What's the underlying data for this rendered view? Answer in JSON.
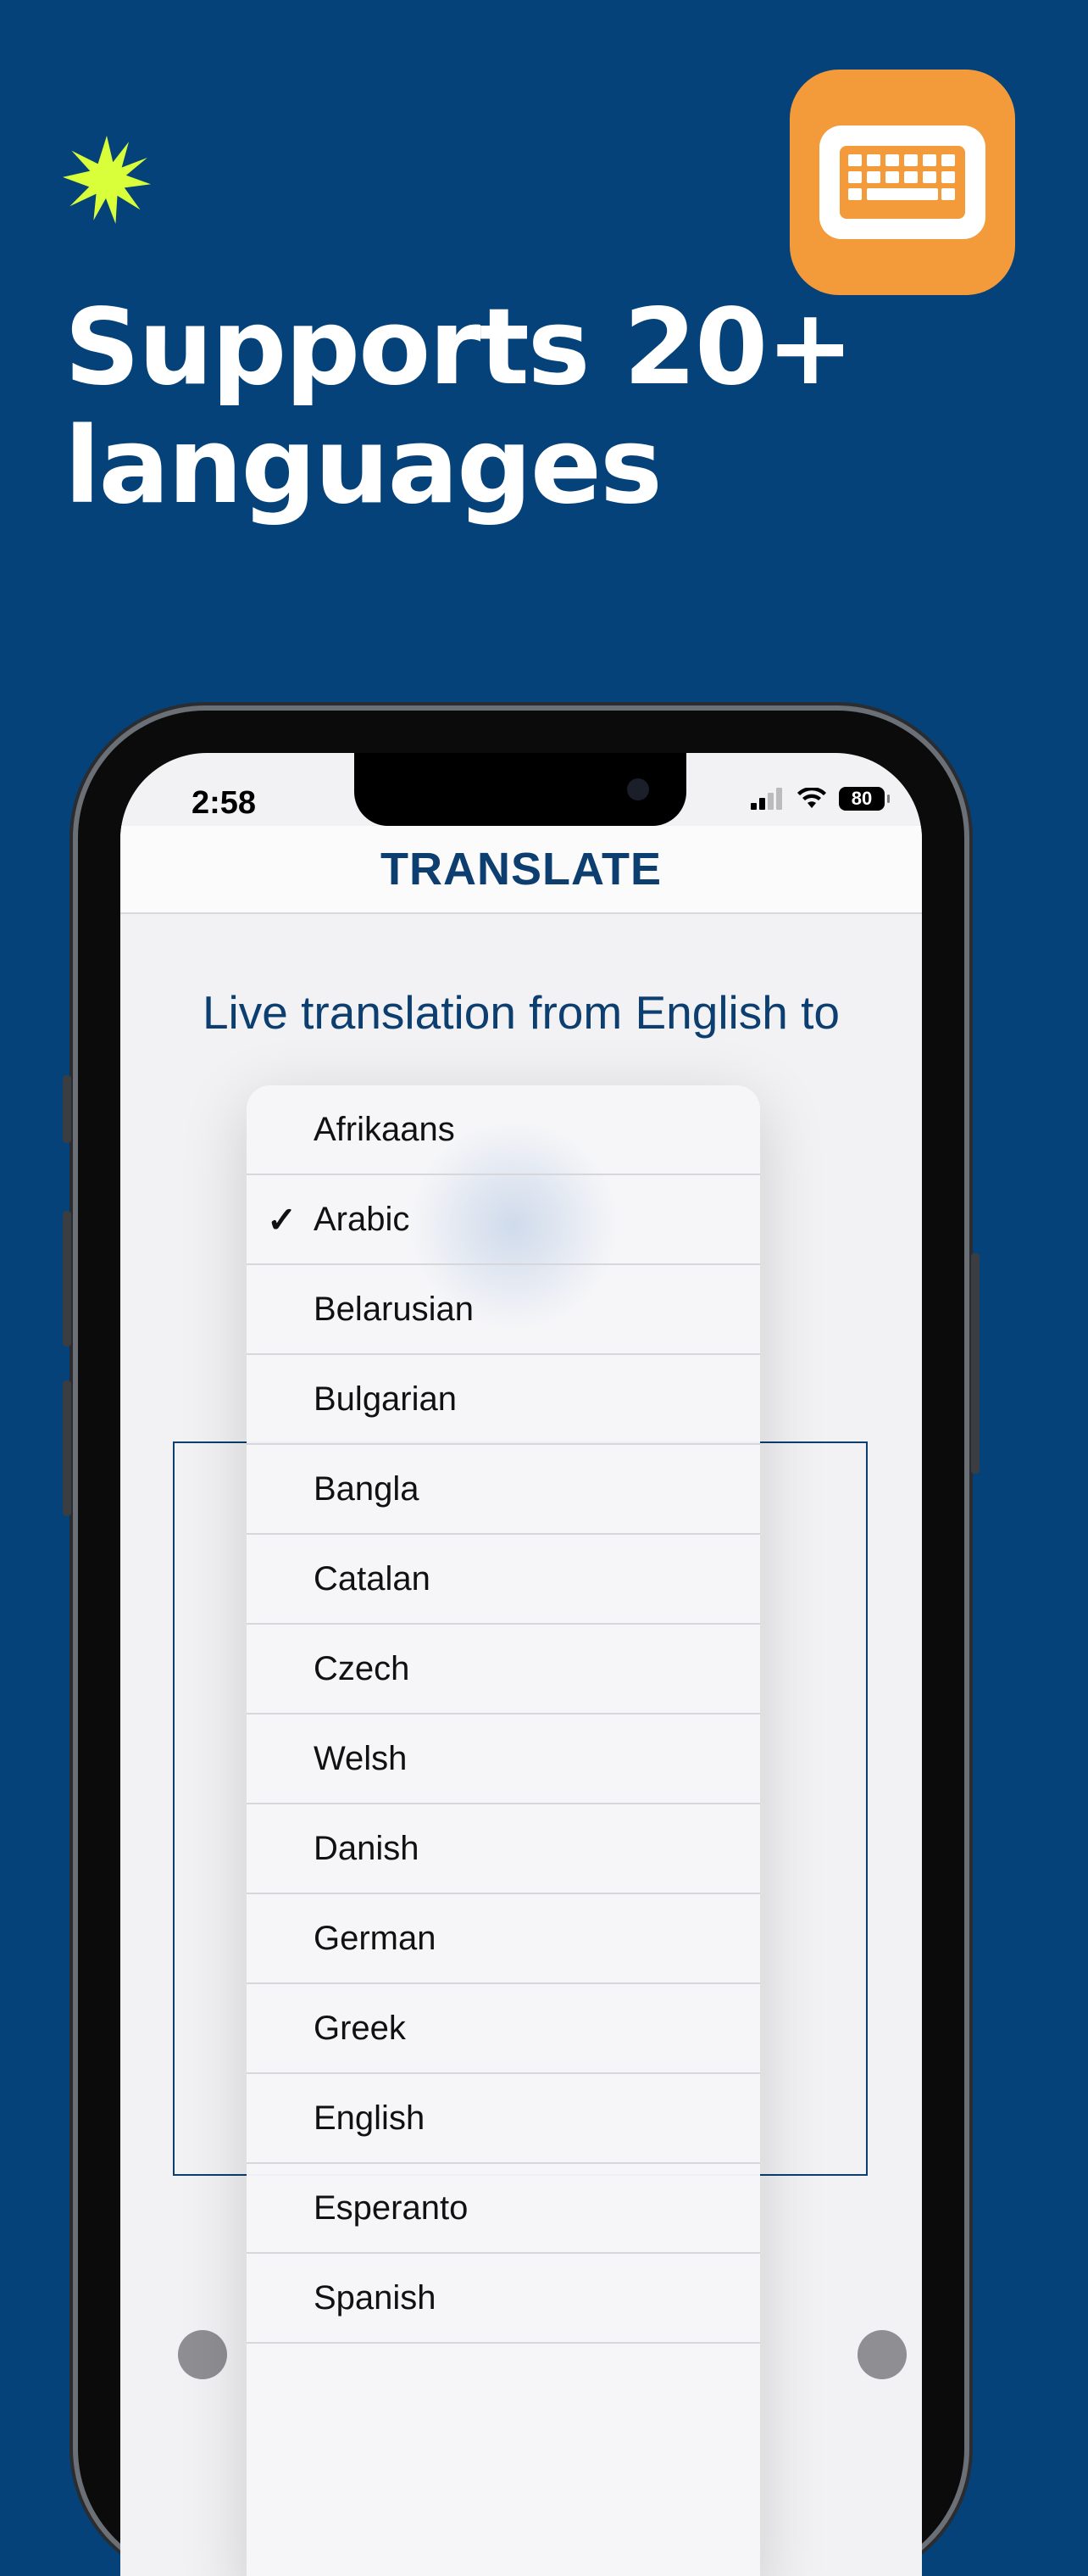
{
  "headline": {
    "line1": "Supports 20+",
    "line2": "languages"
  },
  "colors": {
    "background": "#05427a",
    "accent_burst": "#d8ff3a",
    "app_icon": "#f39a3a",
    "brand_text": "#0c3e70"
  },
  "app_icon": {
    "icon": "keyboard-icon"
  },
  "status_bar": {
    "time": "2:58",
    "battery": "80"
  },
  "nav": {
    "title": "TRANSLATE"
  },
  "main": {
    "subtitle": "Live translation from English to"
  },
  "language_menu": {
    "selected": "Arabic",
    "items": [
      {
        "label": "Afrikaans",
        "check": ""
      },
      {
        "label": "Arabic",
        "check": "✓"
      },
      {
        "label": "Belarusian",
        "check": ""
      },
      {
        "label": "Bulgarian",
        "check": ""
      },
      {
        "label": "Bangla",
        "check": ""
      },
      {
        "label": "Catalan",
        "check": ""
      },
      {
        "label": "Czech",
        "check": ""
      },
      {
        "label": "Welsh",
        "check": ""
      },
      {
        "label": "Danish",
        "check": ""
      },
      {
        "label": "German",
        "check": ""
      },
      {
        "label": "Greek",
        "check": ""
      },
      {
        "label": "English",
        "check": ""
      },
      {
        "label": "Esperanto",
        "check": ""
      },
      {
        "label": "Spanish",
        "check": ""
      }
    ]
  }
}
